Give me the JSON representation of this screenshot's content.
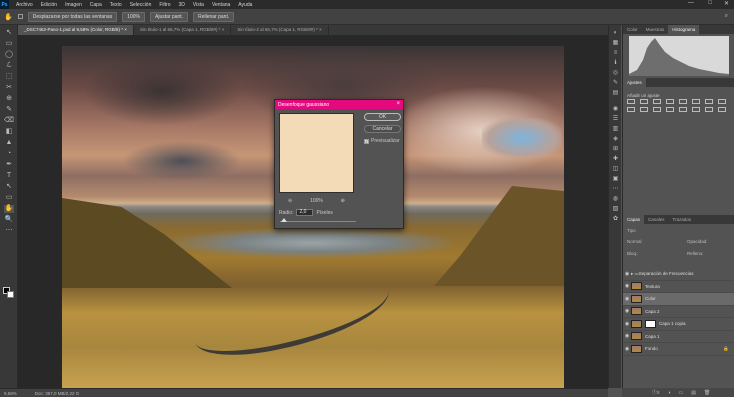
{
  "menubar": {
    "logo": "Ps",
    "items": [
      "Archivo",
      "Edición",
      "Imagen",
      "Capa",
      "Texto",
      "Selección",
      "Filtro",
      "3D",
      "Vista",
      "Ventana",
      "Ayuda"
    ],
    "minimize": "—",
    "maximize": "□",
    "close": "✕"
  },
  "options": {
    "tool_glyph": "✋",
    "scroll_all": "Desplazarse por todas las ventanas",
    "zoom_value": "100%",
    "fit_screen": "Ajustar pant.",
    "fill_screen": "Rellenar pant.",
    "search_glyph": "⌕"
  },
  "tabs": [
    {
      "label": "_DSC7462-Pano-1.psd al 9,58% (Color, RGB/8) *  ×",
      "active": true
    },
    {
      "label": "Sin título-1 al 66,7% (Capa 1, RGB/8#) *  ×",
      "active": false
    },
    {
      "label": "Sin título-2 al 66,7% (Capa 1, RGB/8#) *  ×",
      "active": false
    }
  ],
  "tools": [
    "↖",
    "▭",
    "◯",
    "ℒ",
    "⬚",
    "✂",
    "⊕",
    "✎",
    "⌫",
    "◧",
    "▲",
    "◔",
    "✒",
    "T",
    "↖",
    "▭",
    "✋",
    "🔍",
    "⋯"
  ],
  "dialog": {
    "title": "Desenfoque gaussiano",
    "close": "×",
    "ok": "OK",
    "cancel": "Cancelar",
    "preview_label": "Previsualizar",
    "preview_check": "✓",
    "zoom_out": "⊖",
    "zoom": "100%",
    "zoom_in": "⊕",
    "radius_label": "Radio:",
    "radius_value": "2,0",
    "radius_unit": "Píxeles",
    "slider_fraction": 0.05
  },
  "right_icons": [
    "◐",
    "▦",
    "≡",
    "ℹ",
    "◎",
    "✎",
    "▤",
    "◉",
    "☰",
    "▥",
    "◈",
    "⊞",
    "✚",
    "◫",
    "▣",
    "⋯",
    "◍",
    "▧",
    "✿"
  ],
  "panels": {
    "top_tabs": [
      "Color",
      "Muestras",
      "Histograma"
    ],
    "top_active": "Histograma",
    "adjust_tab": "Ajustes",
    "adjust_label": "Añadir un ajuste",
    "layer_tabs": [
      "Capas",
      "Canales",
      "Trazados"
    ],
    "layer_active": "Capas",
    "kind_label": "Tipo",
    "blend_mode": "Normal",
    "opacity_label": "Opacidad:",
    "lock_label": "Bloq.:",
    "fill_label": "Relleno:",
    "layers": [
      {
        "name": "Separación de Frecuencias",
        "type": "group",
        "selected": false
      },
      {
        "name": "Textura",
        "type": "layer",
        "selected": false
      },
      {
        "name": "Color",
        "type": "layer",
        "selected": true
      },
      {
        "name": "Capa 2",
        "type": "layer",
        "selected": false
      },
      {
        "name": "Capa 1 copia",
        "type": "mask",
        "selected": false
      },
      {
        "name": "Capa 1",
        "type": "layer",
        "selected": false
      },
      {
        "name": "Fondo",
        "type": "locked",
        "selected": false
      }
    ],
    "bottom_icons": [
      "ⓕx",
      "◑",
      "▭",
      "▤",
      "🗑"
    ]
  },
  "status": {
    "zoom": "9,58%",
    "doc": "Doc: 367,0 MB/2,22 G"
  }
}
